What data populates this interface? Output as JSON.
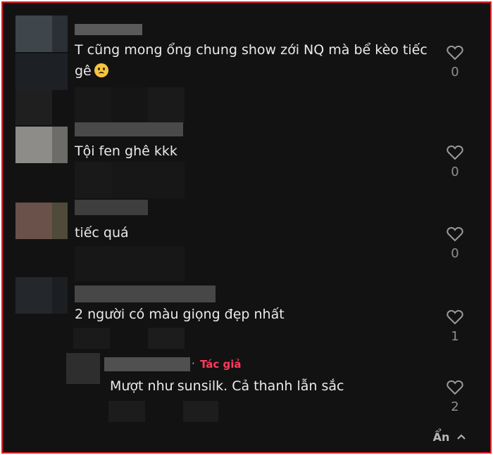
{
  "comments": [
    {
      "text_line1": "T cũng mong ổng chung show zới NQ mà bể kèo tiếc",
      "text_line2": "gê",
      "emoji_icon": "sad-face-emoji",
      "likes": "0"
    },
    {
      "text": "Tội fen ghê kkk",
      "likes": "0"
    },
    {
      "text": "tiếc quá",
      "likes": "0"
    },
    {
      "text": "2 người có màu giọng đẹp nhất",
      "likes": "1"
    }
  ],
  "reply": {
    "separator": "·",
    "author_tag": "Tác giả",
    "text": "Mượt như sunsilk. Cả thanh lẫn sắc",
    "likes": "2"
  },
  "hide_label": "Ẩn",
  "colors": {
    "frame_border": "#e0202a",
    "background": "#121212",
    "author_tag": "#ff3b5c"
  }
}
